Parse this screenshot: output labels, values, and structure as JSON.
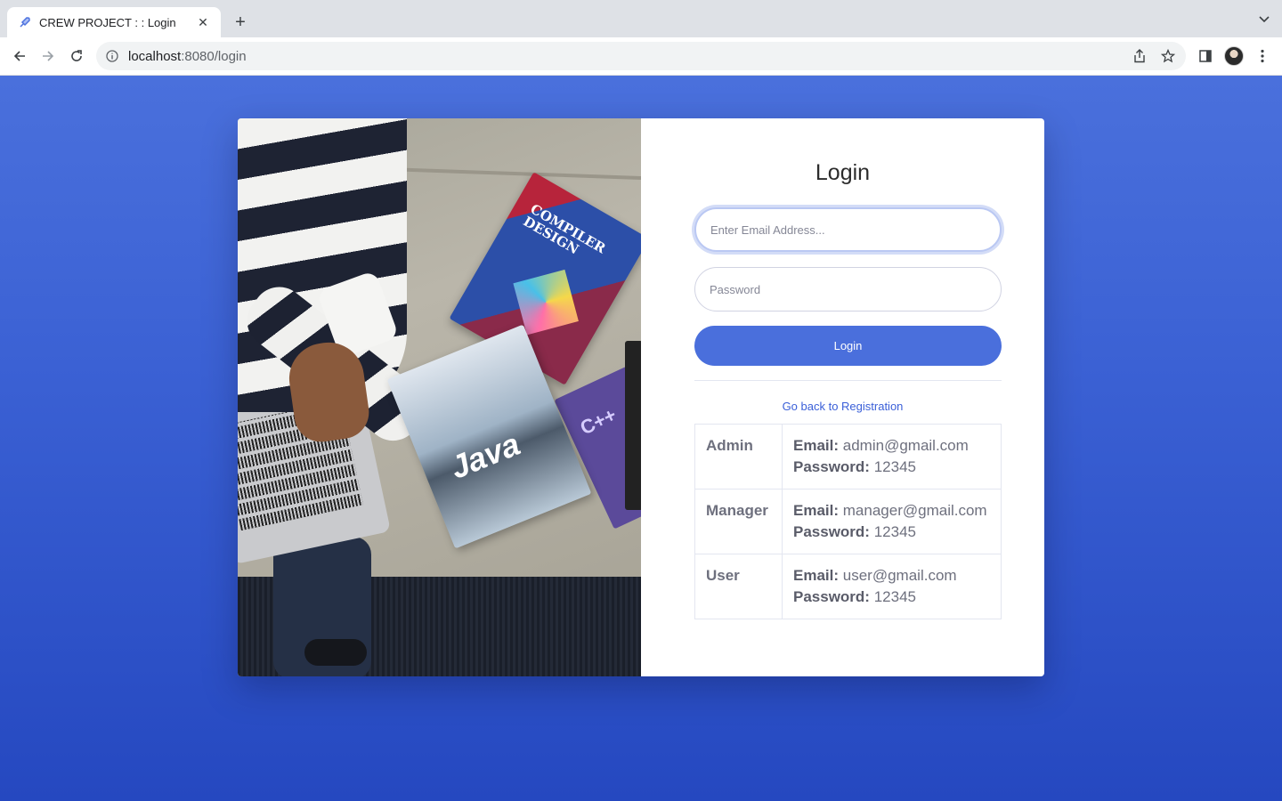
{
  "browser": {
    "tab_title": "CREW PROJECT : : Login",
    "url_host": "localhost",
    "url_path": ":8080/login",
    "tab_close_glyph": "✕",
    "new_tab_glyph": "+",
    "icons": [
      "rocket-favicon-icon",
      "back-arrow-icon",
      "forward-arrow-icon",
      "reload-icon",
      "info-icon",
      "share-icon",
      "star-icon",
      "side-panel-icon",
      "profile-avatar",
      "kebab-menu-icon",
      "tab-search-chevron-icon"
    ]
  },
  "photo": {
    "compiler_book_title": "COMPILER DESIGN",
    "java_book_title": "Java",
    "cpp_book_title": "C++"
  },
  "login": {
    "title": "Login",
    "email_placeholder": "Enter Email Address...",
    "password_placeholder": "Password",
    "button_label": "Login",
    "registration_link": "Go back to Registration",
    "accent_color": "#4a6fdc",
    "credentials": [
      {
        "role": "Admin",
        "email_label": "Email:",
        "email": "admin@gmail.com",
        "password_label": "Password:",
        "password": "12345"
      },
      {
        "role": "Manager",
        "email_label": "Email:",
        "email": "manager@gmail.com",
        "password_label": "Password:",
        "password": "12345"
      },
      {
        "role": "User",
        "email_label": "Email:",
        "email": "user@gmail.com",
        "password_label": "Password:",
        "password": "12345"
      }
    ]
  }
}
